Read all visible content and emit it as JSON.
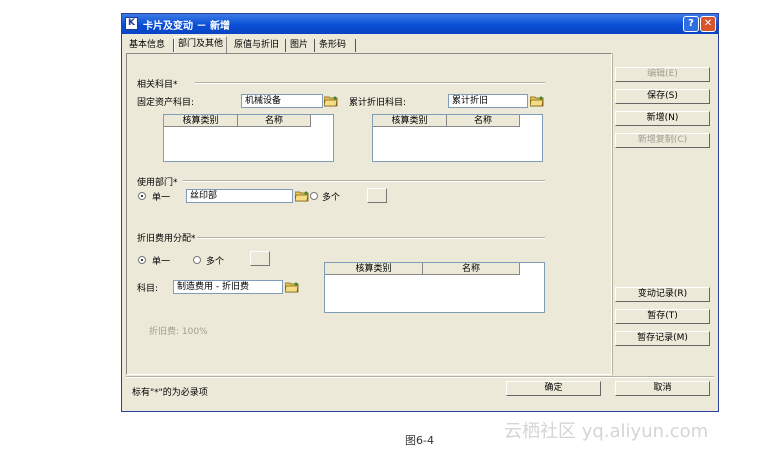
{
  "window": {
    "title": "卡片及变动 － 新增",
    "app_icon": "K",
    "help": "?",
    "close": "✕"
  },
  "tabs": [
    "基本信息",
    "部门及其他",
    "原值与折旧",
    "图片",
    "条形码"
  ],
  "active_tab": "部门及其他",
  "related_accounts": {
    "group_label": "相关科目*",
    "fixed_asset_label": "固定资产科目:",
    "fixed_asset_value": "机械设备",
    "depreciation_label": "累计折旧科目:",
    "depreciation_value": "累计折旧",
    "grid_headers": [
      "核算类别",
      "名称"
    ]
  },
  "department": {
    "group_label": "使用部门*",
    "single_label": "单一",
    "multiple_label": "多个",
    "value": "丝印部"
  },
  "depreciation_alloc": {
    "group_label": "折旧费用分配*",
    "single_label": "单一",
    "multiple_label": "多个",
    "account_label": "科目:",
    "account_value": "制造费用 - 折旧费",
    "grid_headers": [
      "核算类别",
      "名称"
    ],
    "ratio_text": "折旧费: 100%"
  },
  "buttons": {
    "edit": "编辑(E)",
    "save": "保存(S)",
    "new": "新增(N)",
    "new_copy": "新增复制(C)",
    "change_log": "变动记录(R)",
    "temp_save": "暂存(T)",
    "temp_records": "暂存记录(M)",
    "ok": "确定",
    "cancel": "取消"
  },
  "footer_note": "标有\"*\"的为必录项",
  "caption": "图6-4",
  "watermark": "云栖社区 yq.aliyun.com"
}
